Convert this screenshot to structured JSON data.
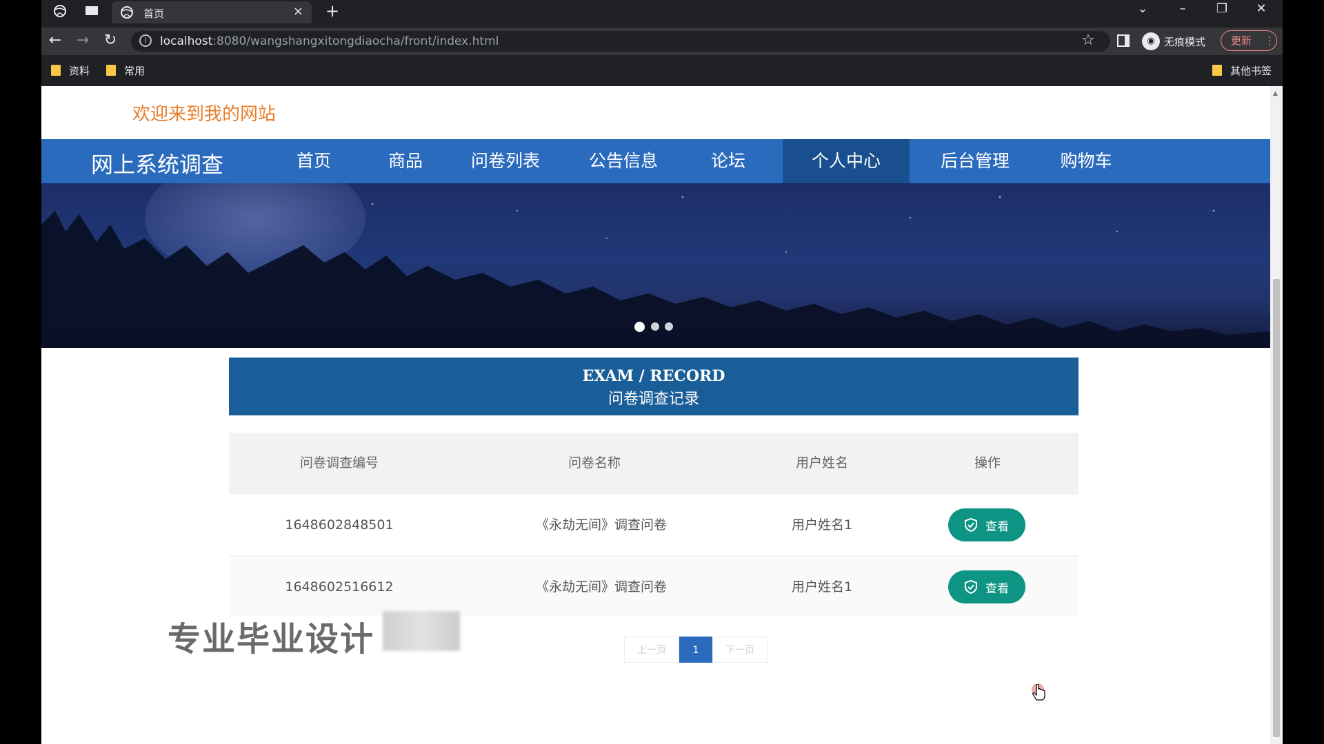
{
  "browser": {
    "tab_title": "首页",
    "url_host": "localhost",
    "url_path": ":8080/wangshangxitongdiaocha/front/index.html",
    "incognito_label": "无痕模式",
    "update_label": "更新",
    "bookmarks": [
      {
        "label": "资料"
      },
      {
        "label": "常用"
      }
    ],
    "other_bookmarks": "其他书签"
  },
  "site": {
    "welcome": "欢迎来到我的网站",
    "name": "网上系统调查",
    "nav": [
      {
        "label": "首页"
      },
      {
        "label": "商品"
      },
      {
        "label": "问卷列表"
      },
      {
        "label": "公告信息"
      },
      {
        "label": "论坛"
      },
      {
        "label": "个人中心",
        "active": true
      },
      {
        "label": "后台管理"
      },
      {
        "label": "购物车"
      }
    ]
  },
  "section": {
    "title_en": "EXAM / RECORD",
    "title_cn": "问卷调查记录"
  },
  "table": {
    "headers": [
      "问卷调查编号",
      "问卷名称",
      "用户姓名",
      "操作"
    ],
    "rows": [
      {
        "id": "1648602848501",
        "name": "《永劫无间》调查问卷",
        "user": "用户姓名1",
        "action": "查看"
      },
      {
        "id": "1648602516612",
        "name": "《永劫无间》调查问卷",
        "user": "用户姓名1",
        "action": "查看"
      }
    ]
  },
  "pagination": {
    "prev": "上一页",
    "current": "1",
    "next": "下一页"
  },
  "watermark": "专业毕业设计",
  "colors": {
    "nav_bg": "#2b6bbd",
    "nav_active": "#1a4f8f",
    "header_bg": "#1a5e99",
    "button": "#0e9484",
    "welcome": "#e87d2b"
  }
}
